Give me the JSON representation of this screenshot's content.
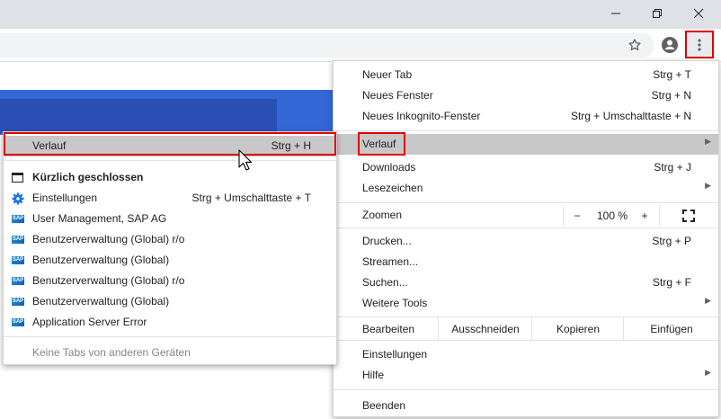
{
  "window": {
    "minimize_icon": "minimize-icon",
    "restore_icon": "restore-icon",
    "close_icon": "close-icon"
  },
  "toolbar": {
    "star_icon": "star-icon",
    "profile_icon": "profile-icon",
    "menu_icon": "kebab-menu-icon"
  },
  "main_menu": {
    "items": [
      {
        "label": "Neuer Tab",
        "shortcut": "Strg + T"
      },
      {
        "label": "Neues Fenster",
        "shortcut": "Strg + N"
      },
      {
        "label": "Neues Inkognito-Fenster",
        "shortcut": "Strg + Umschalttaste + N"
      },
      {
        "label": "Verlauf",
        "shortcut": ""
      },
      {
        "label": "Downloads",
        "shortcut": "Strg + J"
      },
      {
        "label": "Lesezeichen",
        "shortcut": ""
      },
      {
        "label": "Zoomen",
        "shortcut": ""
      },
      {
        "label": "Drucken...",
        "shortcut": "Strg + P"
      },
      {
        "label": "Streamen...",
        "shortcut": ""
      },
      {
        "label": "Suchen...",
        "shortcut": "Strg + F"
      },
      {
        "label": "Weitere Tools",
        "shortcut": ""
      },
      {
        "label": "Einstellungen",
        "shortcut": ""
      },
      {
        "label": "Hilfe",
        "shortcut": ""
      },
      {
        "label": "Beenden",
        "shortcut": ""
      }
    ],
    "zoom": {
      "minus": "−",
      "value": "100 %",
      "plus": "+",
      "fullscreen_icon": "fullscreen-icon"
    },
    "edit": {
      "label": "Bearbeiten",
      "cut": "Ausschneiden",
      "copy": "Kopieren",
      "paste": "Einfügen"
    }
  },
  "history_submenu": {
    "header": {
      "label": "Verlauf",
      "shortcut": "Strg + H"
    },
    "recent_title": "Kürzlich geschlossen",
    "items": [
      {
        "icon": "gear-icon",
        "label": "Einstellungen",
        "shortcut": "Strg + Umschalttaste + T"
      },
      {
        "icon": "sap-logo-icon",
        "label": "User Management, SAP AG",
        "shortcut": ""
      },
      {
        "icon": "sap-logo-icon",
        "label": "Benutzerverwaltung (Global) r/o",
        "shortcut": ""
      },
      {
        "icon": "sap-logo-icon",
        "label": "Benutzerverwaltung (Global)",
        "shortcut": ""
      },
      {
        "icon": "sap-logo-icon",
        "label": "Benutzerverwaltung (Global) r/o",
        "shortcut": ""
      },
      {
        "icon": "sap-logo-icon",
        "label": "Benutzerverwaltung (Global)",
        "shortcut": ""
      },
      {
        "icon": "sap-logo-icon",
        "label": "Application Server Error",
        "shortcut": ""
      }
    ],
    "other_devices": "Keine Tabs von anderen Geräten",
    "sap_logo_text": "SAP"
  }
}
